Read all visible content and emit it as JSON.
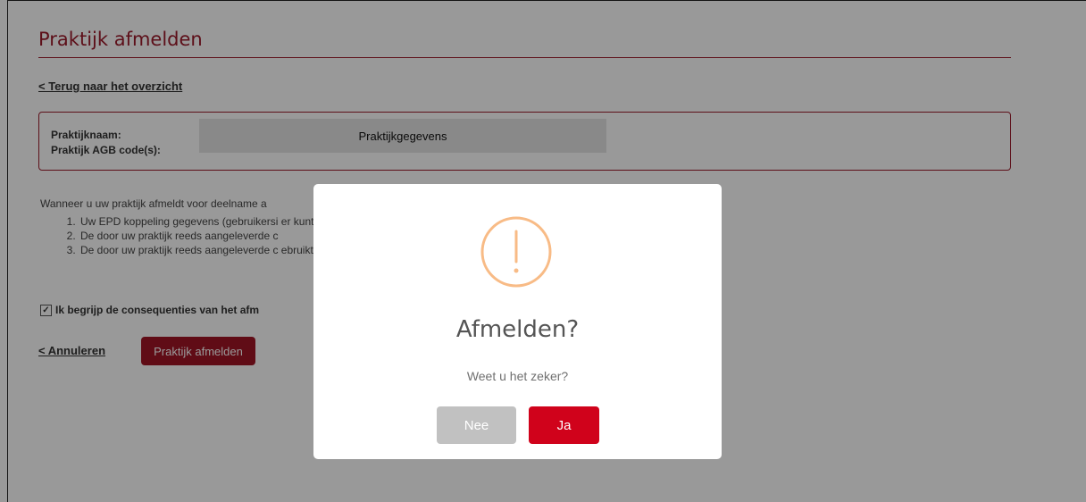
{
  "page": {
    "title": "Praktijk afmelden",
    "back_link": "< Terug naar het overzicht",
    "info": {
      "name_label": "Praktijknaam:",
      "agb_label": "Praktijk AGB code(s):",
      "value": "Praktijkgegevens"
    },
    "intro": "Wanneer u uw praktijk afmeldt voor deelname a",
    "consequences": [
      "Uw EPD koppeling gegevens (gebruikersi                                                                                  er kunt leveren aan de LDF vanuit uw EPD systeem.",
      "De door uw praktijk reeds aangeleverde c",
      "De door uw praktijk reeds aangeleverde c                                                                                  ebruikt voor de berekening van de landelijke benchmark."
    ],
    "consent": {
      "checked": true,
      "label": "Ik begrijp de consequenties van het afm                                                                        oord."
    },
    "cancel_link": "< Annuleren",
    "submit_button": "Praktijk afmelden"
  },
  "modal": {
    "title": "Afmelden?",
    "text": "Weet u het zeker?",
    "no_button": "Nee",
    "yes_button": "Ja",
    "icon": "warning-icon",
    "icon_color": "#f8bb86"
  },
  "colors": {
    "brand": "#9b1a2b",
    "primary_button": "#a01526",
    "confirm_button": "#d0021b",
    "cancel_button": "#c1c1c1"
  }
}
